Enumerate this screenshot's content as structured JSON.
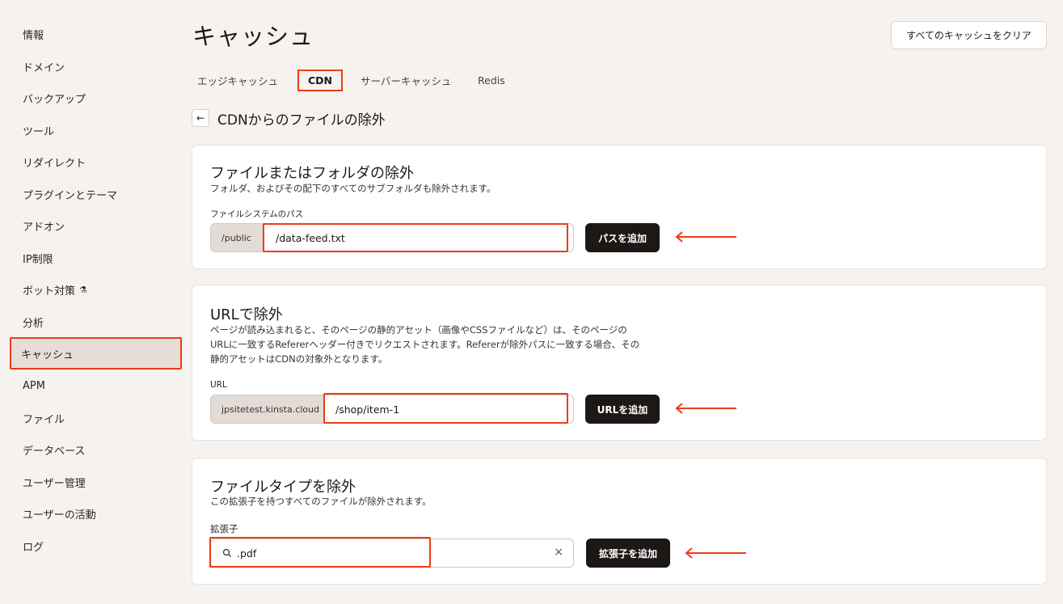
{
  "sidebar": {
    "items": [
      {
        "label": "情報"
      },
      {
        "label": "ドメイン"
      },
      {
        "label": "バックアップ"
      },
      {
        "label": "ツール"
      },
      {
        "label": "リダイレクト"
      },
      {
        "label": "プラグインとテーマ"
      },
      {
        "label": "アドオン"
      },
      {
        "label": "IP制限"
      },
      {
        "label": "ボット対策"
      },
      {
        "label": "分析"
      },
      {
        "label": "キャッシュ"
      },
      {
        "label": "APM"
      },
      {
        "label": "ファイル"
      },
      {
        "label": "データベース"
      },
      {
        "label": "ユーザー管理"
      },
      {
        "label": "ユーザーの活動"
      },
      {
        "label": "ログ"
      }
    ],
    "active": "キャッシュ"
  },
  "header": {
    "title": "キャッシュ",
    "clear_button": "すべてのキャッシュをクリア"
  },
  "tabs": [
    {
      "label": "エッジキャッシュ"
    },
    {
      "label": "CDN"
    },
    {
      "label": "サーバーキャッシュ"
    },
    {
      "label": "Redis"
    }
  ],
  "active_tab": "CDN",
  "subheader": {
    "title": "CDNからのファイルの除外"
  },
  "file_folder": {
    "title": "ファイルまたはフォルダの除外",
    "description": "フォルダ、およびその配下のすべてのサブフォルダも除外されます。",
    "label": "ファイルシステムのパス",
    "prefix": "/public",
    "value": "/data-feed.txt",
    "button": "パスを追加"
  },
  "url": {
    "title": "URLで除外",
    "description_lines": [
      "ページが読み込まれると、そのページの静的アセット（画像やCSSファイルなど）は、そのページの",
      "URLに一致するRefererヘッダー付きでリクエストされます。Refererが除外パスに一致する場合、その",
      "静的アセットはCDNの対象外となります。"
    ],
    "label": "URL",
    "prefix": "jpsitetest.kinsta.cloud",
    "value": "/shop/item-1",
    "button": "URLを追加"
  },
  "file_type": {
    "title": "ファイルタイプを除外",
    "description": "この拡張子を持つすべてのファイルが除外されます。",
    "label": "拡張子",
    "value": ".pdf",
    "button": "拡張子を追加"
  },
  "colors": {
    "accent": "#ee3b17",
    "background": "#f6f2ef",
    "button": "#1d1716"
  }
}
